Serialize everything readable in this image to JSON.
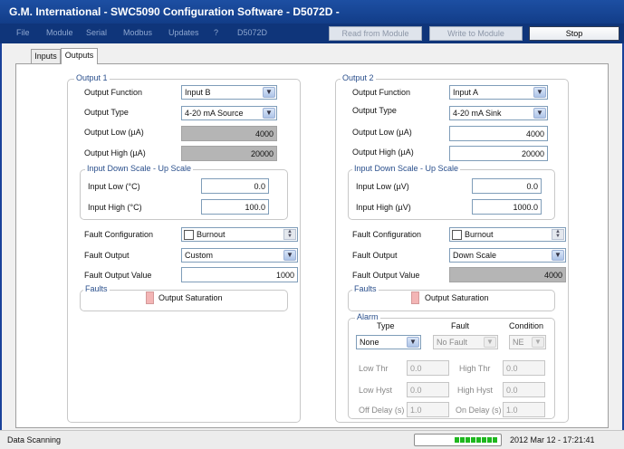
{
  "window": {
    "title": "G.M. International - SWC5090 Configuration Software - D5072D -"
  },
  "menu": {
    "items": [
      "File",
      "Module",
      "Serial",
      "Modbus",
      "Updates",
      "?",
      "D5072D"
    ],
    "read_label": "Read from Module",
    "write_label": "Write to Module",
    "stop_label": "Stop"
  },
  "tabs": [
    "Inputs",
    "Outputs"
  ],
  "output1": {
    "title": "Output 1",
    "function_label": "Output Function",
    "function_value": "Input B",
    "type_label": "Output Type",
    "type_value": "4-20 mA Source",
    "low_label": "Output Low (µA)",
    "low_value": "4000",
    "high_label": "Output High (µA)",
    "high_value": "20000",
    "scale_title": "Input Down Scale - Up Scale",
    "in_low_label": "Input Low (°C)",
    "in_low_value": "0.0",
    "in_high_label": "Input High (°C)",
    "in_high_value": "100.0",
    "fault_config_label": "Fault Configuration",
    "fault_config_value": "Burnout",
    "fault_output_label": "Fault Output",
    "fault_output_value": "Custom",
    "fault_value_label": "Fault Output Value",
    "fault_value": "1000",
    "faults_title": "Faults",
    "saturation_label": "Output Saturation"
  },
  "output2": {
    "title": "Output 2",
    "function_label": "Output Function",
    "function_value": "Input A",
    "type_label": "Output Type",
    "type_value": "4-20 mA Sink",
    "low_label": "Output Low (µA)",
    "low_value": "4000",
    "high_label": "Output High (µA)",
    "high_value": "20000",
    "scale_title": "Input Down Scale - Up Scale",
    "in_low_label": "Input Low (µV)",
    "in_low_value": "0.0",
    "in_high_label": "Input High (µV)",
    "in_high_value": "1000.0",
    "fault_config_label": "Fault Configuration",
    "fault_config_value": "Burnout",
    "fault_output_label": "Fault Output",
    "fault_output_value": "Down Scale",
    "fault_value_label": "Fault Output Value",
    "fault_value": "4000",
    "faults_title": "Faults",
    "saturation_label": "Output Saturation",
    "alarm": {
      "title": "Alarm",
      "type_header": "Type",
      "fault_header": "Fault",
      "condition_header": "Condition",
      "type_value": "None",
      "fault_value": "No Fault",
      "condition_value": "NE",
      "low_thr_label": "Low Thr",
      "low_thr_value": "0.0",
      "high_thr_label": "High Thr",
      "high_thr_value": "0.0",
      "low_hyst_label": "Low Hyst",
      "low_hyst_value": "0.0",
      "high_hyst_label": "High Hyst",
      "high_hyst_value": "0.0",
      "off_delay_label": "Off Delay (s)",
      "off_delay_value": "1.0",
      "on_delay_label": "On Delay (s)",
      "on_delay_value": "1.0"
    }
  },
  "status": {
    "text": "Data Scanning",
    "progress": 0.55,
    "datetime": "2012 Mar 12 - 17:21:41"
  },
  "colors": {
    "titlebar": "#1d4fa3",
    "progress": "#1fb81f",
    "readonly_field": "#b5b5b5",
    "fault_led": "#f3b5b5"
  }
}
